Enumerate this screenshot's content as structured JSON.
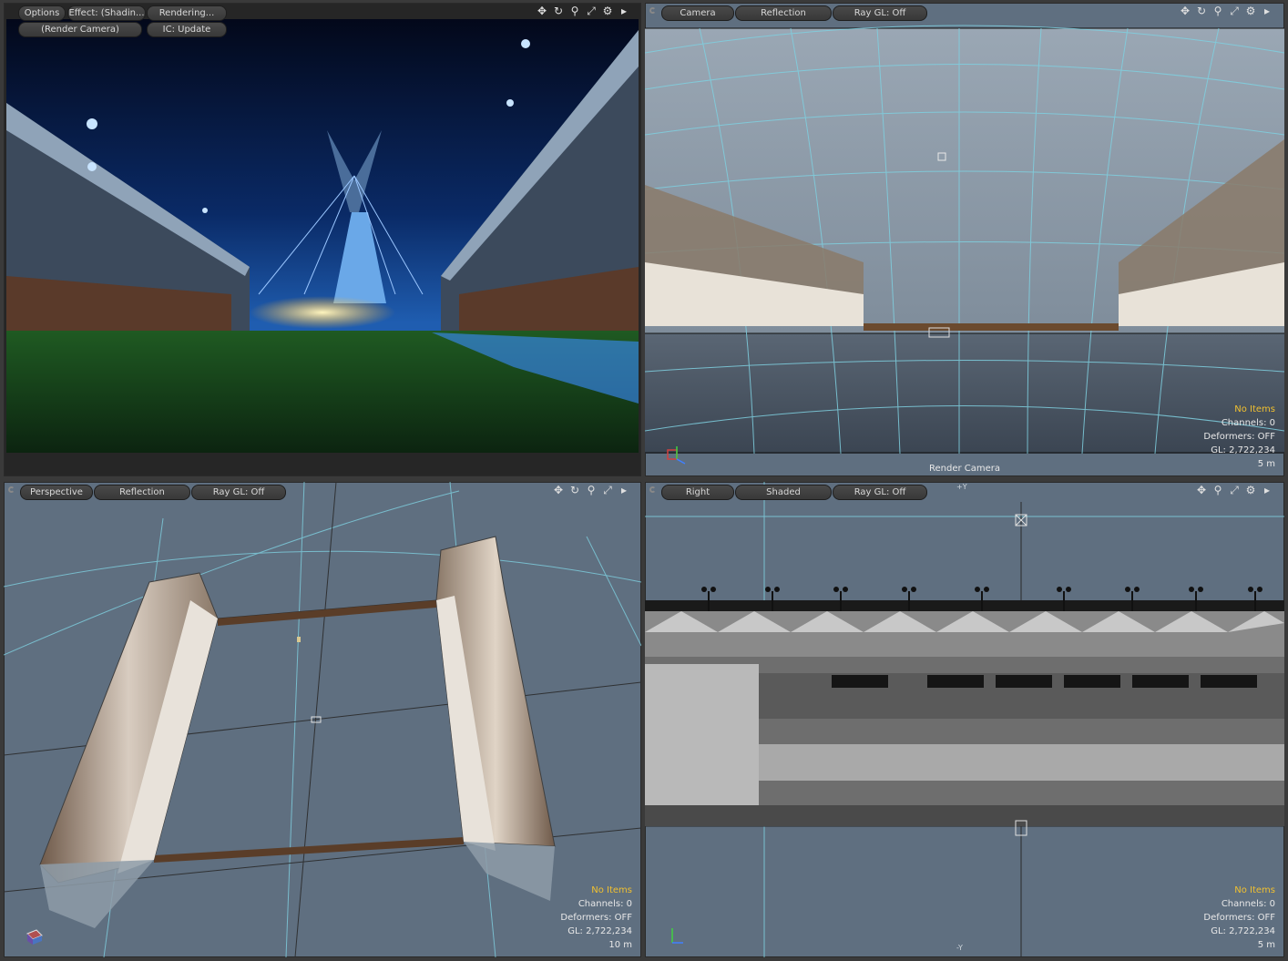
{
  "render_view": {
    "buttons": {
      "options": "Options",
      "effect": "Effect: (Shadin...",
      "rendering": "Rendering...",
      "render_camera": "(Render Camera)",
      "ic_update": "IC: Update"
    }
  },
  "camera_view": {
    "tabs": [
      "Camera",
      "Reflection",
      "Ray GL: Off"
    ],
    "hud": {
      "items": "No Items",
      "channels": "Channels: 0",
      "deformers": "Deformers: OFF",
      "gl": "GL: 2,722,234",
      "scale": "5 m"
    },
    "label": "Render Camera"
  },
  "perspective_view": {
    "tabs": [
      "Perspective",
      "Reflection",
      "Ray GL: Off"
    ],
    "hud": {
      "items": "No Items",
      "channels": "Channels: 0",
      "deformers": "Deformers: OFF",
      "gl": "GL: 2,722,234",
      "scale": "10 m"
    }
  },
  "right_view": {
    "tabs": [
      "Right",
      "Shaded",
      "Ray GL: Off"
    ],
    "axis_top": "+Y",
    "axis_bottom": "-Y",
    "hud": {
      "items": "No Items",
      "channels": "Channels: 0",
      "deformers": "Deformers: OFF",
      "gl": "GL: 2,722,234",
      "scale": "5 m"
    }
  },
  "nav_icons": [
    "move-icon",
    "rotate-icon",
    "zoom-icon",
    "fit-icon",
    "gear-icon",
    "arrow-right-icon"
  ],
  "colors": {
    "viewport_bg": "#5f6f80",
    "hud_warn": "#f0c030",
    "grid": "#7fd0e0"
  }
}
